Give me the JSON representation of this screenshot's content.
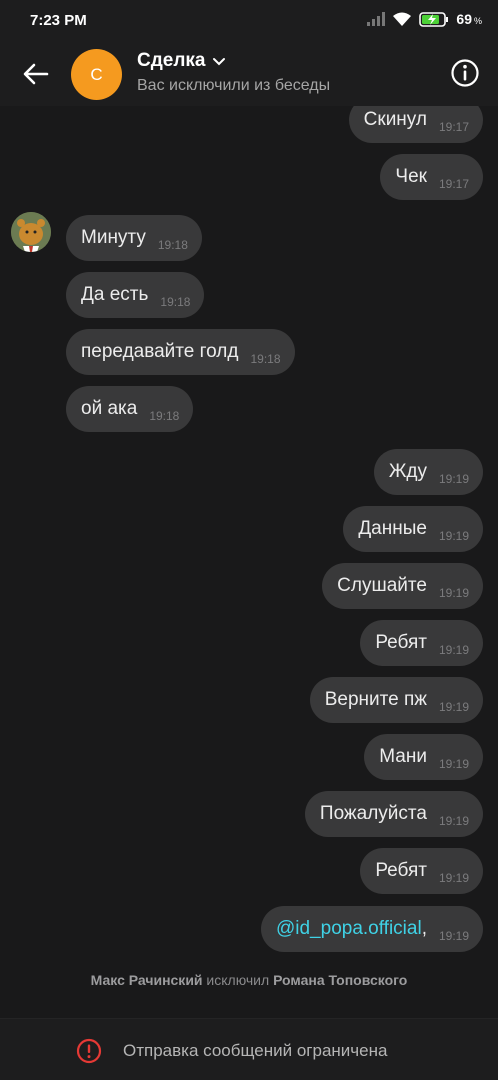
{
  "status": {
    "time": "7:23 PM",
    "battery": "69",
    "battery_unit": "%"
  },
  "header": {
    "avatar_letter": "C",
    "title": "Сделка",
    "subtitle": "Вас исключили из беседы"
  },
  "messages": [
    {
      "dir": "out",
      "text": "Скинул",
      "time": "19:17"
    },
    {
      "dir": "out",
      "text": "Чек",
      "time": "19:17"
    },
    {
      "dir": "in",
      "text": "Минуту",
      "time": "19:18"
    },
    {
      "dir": "in",
      "text": "Да есть",
      "time": "19:18"
    },
    {
      "dir": "in",
      "text": "передавайте голд",
      "time": "19:18"
    },
    {
      "dir": "in",
      "text": "ой ака",
      "time": "19:18"
    },
    {
      "dir": "out",
      "text": "Жду",
      "time": "19:19"
    },
    {
      "dir": "out",
      "text": "Данные",
      "time": "19:19"
    },
    {
      "dir": "out",
      "text": "Слушайте",
      "time": "19:19"
    },
    {
      "dir": "out",
      "text": "Ребят",
      "time": "19:19"
    },
    {
      "dir": "out",
      "text": "Верните пж",
      "time": "19:19"
    },
    {
      "dir": "out",
      "text": "Мани",
      "time": "19:19"
    },
    {
      "dir": "out",
      "text": "Пожалуйста",
      "time": "19:19"
    },
    {
      "dir": "out",
      "text": "Ребят",
      "time": "19:19"
    },
    {
      "dir": "out",
      "mention": "@id_popa.official",
      "text": ",",
      "time": "19:19"
    }
  ],
  "system_message": {
    "actor": "Макс Рачинский",
    "action": "исключил",
    "target": "Романа Топовского"
  },
  "footer": {
    "text": "Отправка сообщений ограничена"
  },
  "colors": {
    "accent_avatar": "#f59a1f",
    "mention": "#3fd2e6",
    "warning": "#e53935",
    "bubble": "#39393a",
    "background": "#19191a"
  }
}
